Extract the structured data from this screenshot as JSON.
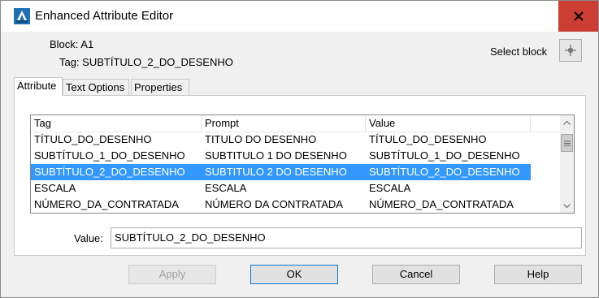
{
  "window": {
    "title": "Enhanced Attribute Editor",
    "icons": {
      "app": "autocad-icon",
      "close": "close-icon"
    }
  },
  "info": {
    "block_label": "Block: A1",
    "tag_label": "Tag: SUBTÍTULO_2_DO_DESENHO",
    "select_block_label": "Select block",
    "select_block_icon": "pick-point-icon"
  },
  "tabs": [
    {
      "label": "Attribute",
      "active": true
    },
    {
      "label": "Text Options",
      "active": false
    },
    {
      "label": "Properties",
      "active": false
    }
  ],
  "grid": {
    "columns": [
      "Tag",
      "Prompt",
      "Value"
    ],
    "rows": [
      {
        "tag": "TÍTULO_DO_DESENHO",
        "prompt": "TITULO DO DESENHO",
        "value": "TÍTULO_DO_DESENHO",
        "selected": false
      },
      {
        "tag": "SUBTÍTULO_1_DO_DESENHO",
        "prompt": "SUBTITULO 1 DO DESENHO",
        "value": "SUBTÍTULO_1_DO_DESENHO",
        "selected": false
      },
      {
        "tag": "SUBTÍTULO_2_DO_DESENHO",
        "prompt": "SUBTITULO 2 DO DESENHO",
        "value": "SUBTÍTULO_2_DO_DESENHO",
        "selected": true
      },
      {
        "tag": "ESCALA",
        "prompt": "ESCALA",
        "value": "ESCALA",
        "selected": false
      },
      {
        "tag": "NÚMERO_DA_CONTRATADA",
        "prompt": "NÚMERO DA CONTRATADA",
        "value": "NÚMERO_DA_CONTRATADA",
        "selected": false
      }
    ]
  },
  "value_field": {
    "label": "Value:",
    "value": "SUBTÍTULO_2_DO_DESENHO"
  },
  "buttons": {
    "apply": "Apply",
    "ok": "OK",
    "cancel": "Cancel",
    "help": "Help"
  },
  "colors": {
    "selection": "#3399ff",
    "close_button": "#cc3d34"
  }
}
